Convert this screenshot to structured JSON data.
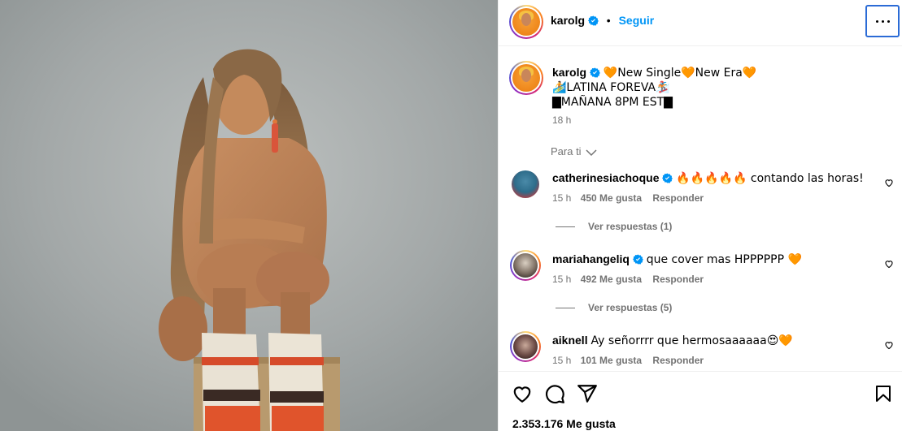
{
  "post": {
    "author": "karolg",
    "follow_label": "Seguir",
    "separator": "•",
    "caption": {
      "line1_a": "🧡New Single🧡New Era🧡",
      "line2": "🏄LATINA FOREVA🏂",
      "line3": "▇MAÑANA 8PM EST▇",
      "time": "18 h"
    },
    "for_you_label": "Para ti"
  },
  "comments": [
    {
      "user": "catherinesiachoque",
      "verified": true,
      "text": "🔥🔥🔥🔥🔥 contando las horas!",
      "time": "15 h",
      "likes": "450 Me gusta",
      "reply": "Responder",
      "view_replies": "Ver respuestas (1)"
    },
    {
      "user": "mariahangeliq",
      "verified": true,
      "text": "que cover mas HPPPPPP 🧡",
      "time": "15 h",
      "likes": "492 Me gusta",
      "reply": "Responder",
      "view_replies": "Ver respuestas (5)"
    },
    {
      "user": "aiknell",
      "verified": false,
      "text": "Ay señorrrr que hermosaaaaaa😍🧡",
      "time": "15 h",
      "likes": "101 Me gusta",
      "reply": "Responder"
    }
  ],
  "footer": {
    "likes_count": "2.353.176 Me gusta"
  },
  "icons": {
    "like": "heart-icon",
    "comment": "comment-icon",
    "share": "share-icon",
    "save": "bookmark-icon",
    "more": "more-options-icon",
    "verified": "verified-badge-icon",
    "chevron": "chevron-down-icon"
  },
  "colors": {
    "follow": "#0095f6",
    "verified": "#0095f6",
    "muted": "#737373",
    "focus_outline": "#2b6bd6"
  }
}
